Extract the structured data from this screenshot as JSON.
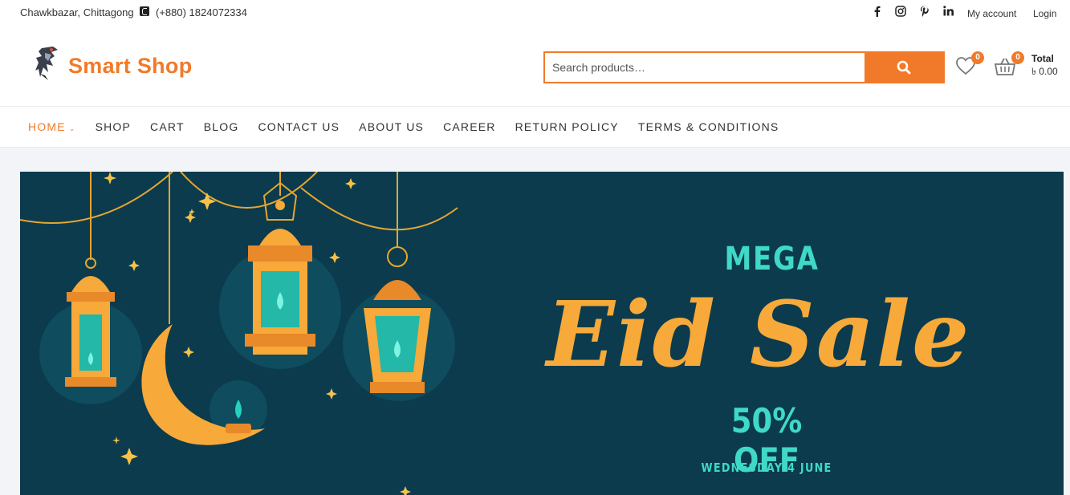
{
  "topbar": {
    "address": "Chawkbazar, Chittagong",
    "phone": "(+880) 1824072334",
    "social_icons": [
      "facebook-icon",
      "instagram-icon",
      "pinterest-icon",
      "linkedin-icon"
    ],
    "my_account": "My account",
    "login": "Login"
  },
  "header": {
    "logo_text": "Smart Shop",
    "search_placeholder": "Search products…",
    "wishlist_count": "0",
    "cart_count": "0",
    "total_label": "Total",
    "total_value": "৳ 0.00"
  },
  "nav": {
    "items": [
      {
        "label": "HOME",
        "active": true
      },
      {
        "label": "SHOP"
      },
      {
        "label": "CART"
      },
      {
        "label": "BLOG"
      },
      {
        "label": "CONTACT US"
      },
      {
        "label": "ABOUT US"
      },
      {
        "label": "CAREER"
      },
      {
        "label": "RETURN POLICY"
      },
      {
        "label": "TERMS & CONDITIONS"
      }
    ]
  },
  "banner": {
    "line1": "MEGA",
    "title": "Eid Sale",
    "discount": "50% OFF",
    "date": "WEDNESDAY 4 JUNE"
  },
  "colors": {
    "accent": "#f17a2a",
    "banner_bg": "#0b3b4d",
    "banner_teal": "#3fd9c6",
    "banner_gold": "#f7a93a"
  }
}
